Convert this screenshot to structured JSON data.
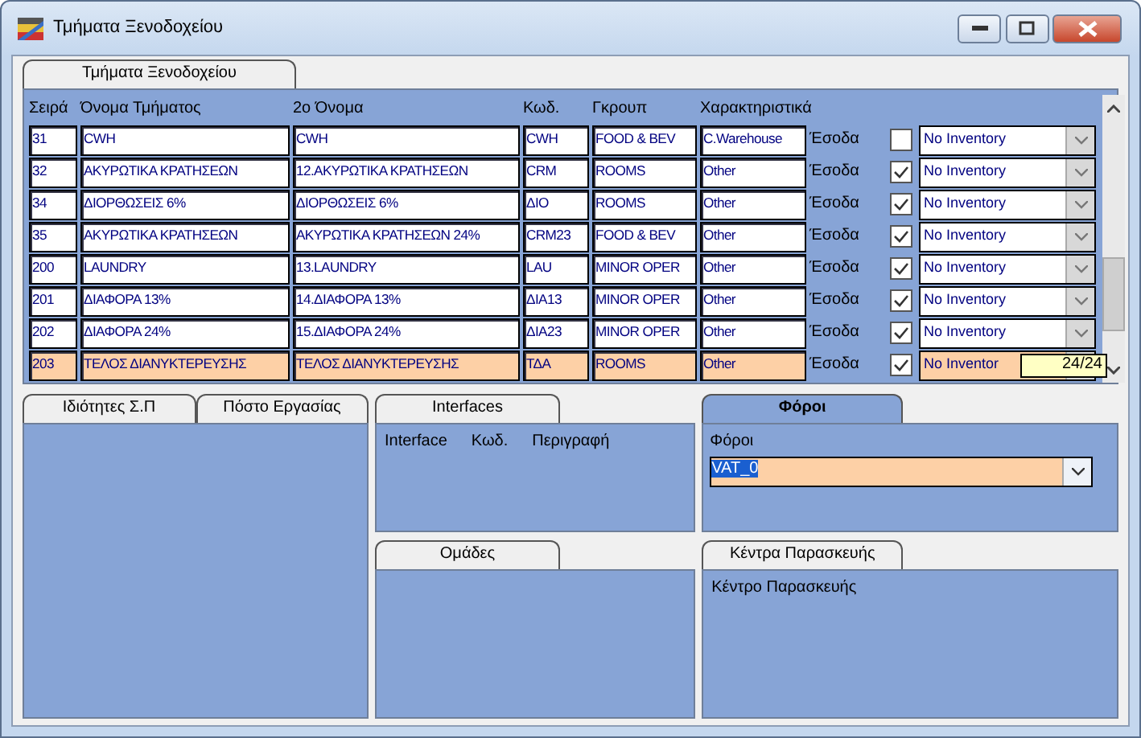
{
  "window": {
    "title": "Τμήματα Ξενοδοχείου"
  },
  "main_tab": {
    "label": "Τμήματα Ξενοδοχείου",
    "selected": false
  },
  "table": {
    "columns": [
      "Σειρά",
      "Όνομα Τμήματος",
      "2ο Όνομα",
      "Κωδ.",
      "Γκρουπ",
      "Χαρακτηριστικά"
    ],
    "rows": [
      {
        "cells": [
          "31",
          "CWH",
          "CWH",
          "CWH",
          "FOOD & BEV",
          "C.Warehouse"
        ],
        "type_label": "Έσοδα",
        "checked": false,
        "inventory": "No Inventory",
        "selected": false
      },
      {
        "cells": [
          "32",
          "ΑΚΥΡΩΤΙΚΑ ΚΡΑΤΗΣΕΩΝ",
          "12.ΑΚΥΡΩΤΙΚΑ ΚΡΑΤΗΣΕΩΝ",
          "CRM",
          "ROOMS",
          "Other"
        ],
        "type_label": "Έσοδα",
        "checked": true,
        "inventory": "No Inventory",
        "selected": false
      },
      {
        "cells": [
          "34",
          "ΔΙΟΡΘΩΣΕΙΣ 6%",
          "ΔΙΟΡΘΩΣΕΙΣ 6%",
          "ΔΙΟ",
          "ROOMS",
          "Other"
        ],
        "type_label": "Έσοδα",
        "checked": true,
        "inventory": "No Inventory",
        "selected": false
      },
      {
        "cells": [
          "35",
          "ΑΚΥΡΩΤΙΚΑ ΚΡΑΤΗΣΕΩΝ",
          "ΑΚΥΡΩΤΙΚΑ ΚΡΑΤΗΣΕΩΝ 24%",
          "CRM23",
          "FOOD & BEV",
          "Other"
        ],
        "type_label": "Έσοδα",
        "checked": true,
        "inventory": "No Inventory",
        "selected": false
      },
      {
        "cells": [
          "200",
          "LAUNDRY",
          "13.LAUNDRY",
          "LAU",
          "MINOR OPER",
          "Other"
        ],
        "type_label": "Έσοδα",
        "checked": true,
        "inventory": "No Inventory",
        "selected": false
      },
      {
        "cells": [
          "201",
          "ΔΙΑΦΟΡΑ 13%",
          "14.ΔΙΑΦΟΡΑ 13%",
          "ΔΙΑ13",
          "MINOR OPER",
          "Other"
        ],
        "type_label": "Έσοδα",
        "checked": true,
        "inventory": "No Inventory",
        "selected": false
      },
      {
        "cells": [
          "202",
          "ΔΙΑΦΟΡΑ 24%",
          "15.ΔΙΑΦΟΡΑ 24%",
          "ΔΙΑ23",
          "MINOR OPER",
          "Other"
        ],
        "type_label": "Έσοδα",
        "checked": true,
        "inventory": "No Inventory",
        "selected": false
      },
      {
        "cells": [
          "203",
          "ΤΕΛΟΣ ΔΙΑΝΥΚΤΕΡΕΥΣΗΣ",
          "ΤΕΛΟΣ ΔΙΑΝΥΚΤΕΡΕΥΣΗΣ",
          "ΤΔΑ",
          "ROOMS",
          "Other"
        ],
        "type_label": "Έσοδα",
        "checked": true,
        "inventory": "No Inventor",
        "selected": true
      }
    ],
    "record_counter": "24/24"
  },
  "properties_panel": {
    "tabs": [
      {
        "label": "Ιδιότητες Σ.Π",
        "selected": false
      },
      {
        "label": "Πόστο Εργασίας",
        "selected": false
      }
    ]
  },
  "interfaces_panel": {
    "tabs": [
      {
        "label": "Interfaces",
        "selected": false
      }
    ],
    "columns": [
      "Interface",
      "Κωδ.",
      "Περιγραφή"
    ]
  },
  "groups_panel": {
    "tabs": [
      {
        "label": "Ομάδες",
        "selected": false
      }
    ]
  },
  "taxes_panel": {
    "tabs": [
      {
        "label": "Φόροι",
        "selected": true
      }
    ],
    "field_label": "Φόροι",
    "value": "VAT_0"
  },
  "prep_centers_panel": {
    "tabs": [
      {
        "label": "Κέντρα Παρασκευής",
        "selected": false
      }
    ],
    "label": "Κέντρο Παρασκευής"
  }
}
